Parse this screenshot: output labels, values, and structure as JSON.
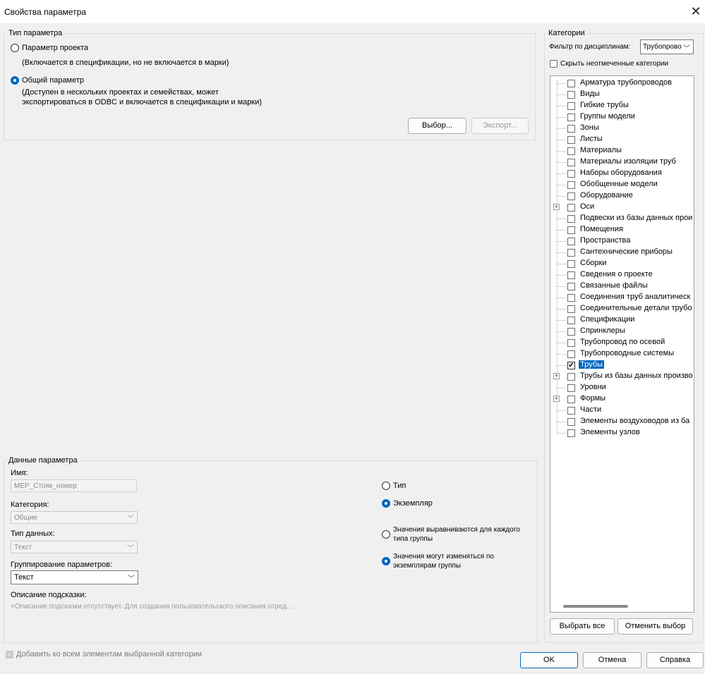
{
  "window": {
    "title": "Свойства параметра"
  },
  "param_type": {
    "legend": "Тип параметра",
    "project_label": "Параметр проекта",
    "project_desc": "(Включается в спецификации, но не включается в марки)",
    "shared_label": "Общий параметр",
    "shared_desc_1": "(Доступен в нескольких проектах и семействах, может",
    "shared_desc_2": "экспортироваться в ODBC и включается в спецификации и марки)",
    "select_btn": "Выбор...",
    "export_btn": "Экспорт..."
  },
  "param_data": {
    "legend": "Данные параметра",
    "name_label": "Имя:",
    "name_value": "MEP_Стояк_номер",
    "category_label": "Категория:",
    "category_value": "Общие",
    "datatype_label": "Тип данных:",
    "datatype_value": "Текст",
    "grouping_label": "Группирование параметров:",
    "grouping_value": "Текст",
    "tooltip_label": "Описание подсказки:",
    "tooltip_value": "<Описание подсказки отсутствует. Для создания пользовательского описания отред...",
    "type_label": "Тип",
    "instance_label": "Экземпляр",
    "align_1": "Значения выравниваются для каждого",
    "align_2": "типа группы",
    "vary_1": "Значения могут изменяться по",
    "vary_2": "экземплярам группы"
  },
  "categories": {
    "legend": "Категории",
    "filter_label": "Фильтр по дисциплинам:",
    "filter_value": "Трубопрово",
    "hide_unchecked": "Скрыть неотмеченные категории",
    "items": [
      "Арматура трубопроводов",
      "Виды",
      "Гибкие трубы",
      "Группы модели",
      "Зоны",
      "Листы",
      "Материалы",
      "Материалы изоляции труб",
      "Наборы оборудования",
      "Обобщенные модели",
      "Оборудование",
      "Оси",
      "Подвески из базы данных прои",
      "Помещения",
      "Пространства",
      "Сантехнические приборы",
      "Сборки",
      "Сведения о проекте",
      "Связанные файлы",
      "Соединения труб аналитическ",
      "Соединительные детали трубо",
      "Спецификации",
      "Спринклеры",
      "Трубопровод по осевой",
      "Трубопроводные системы",
      "Трубы",
      "Трубы из базы данных произво",
      "Уровни",
      "Формы",
      "Части",
      "Элементы воздуховодов из ба",
      "Элементы узлов"
    ],
    "select_all": "Выбрать все",
    "deselect": "Отменить выбор"
  },
  "footer": {
    "add_all": "Добавить ко всем элементам выбранной категории",
    "ok": "OK",
    "cancel": "Отмена",
    "help": "Справка"
  }
}
